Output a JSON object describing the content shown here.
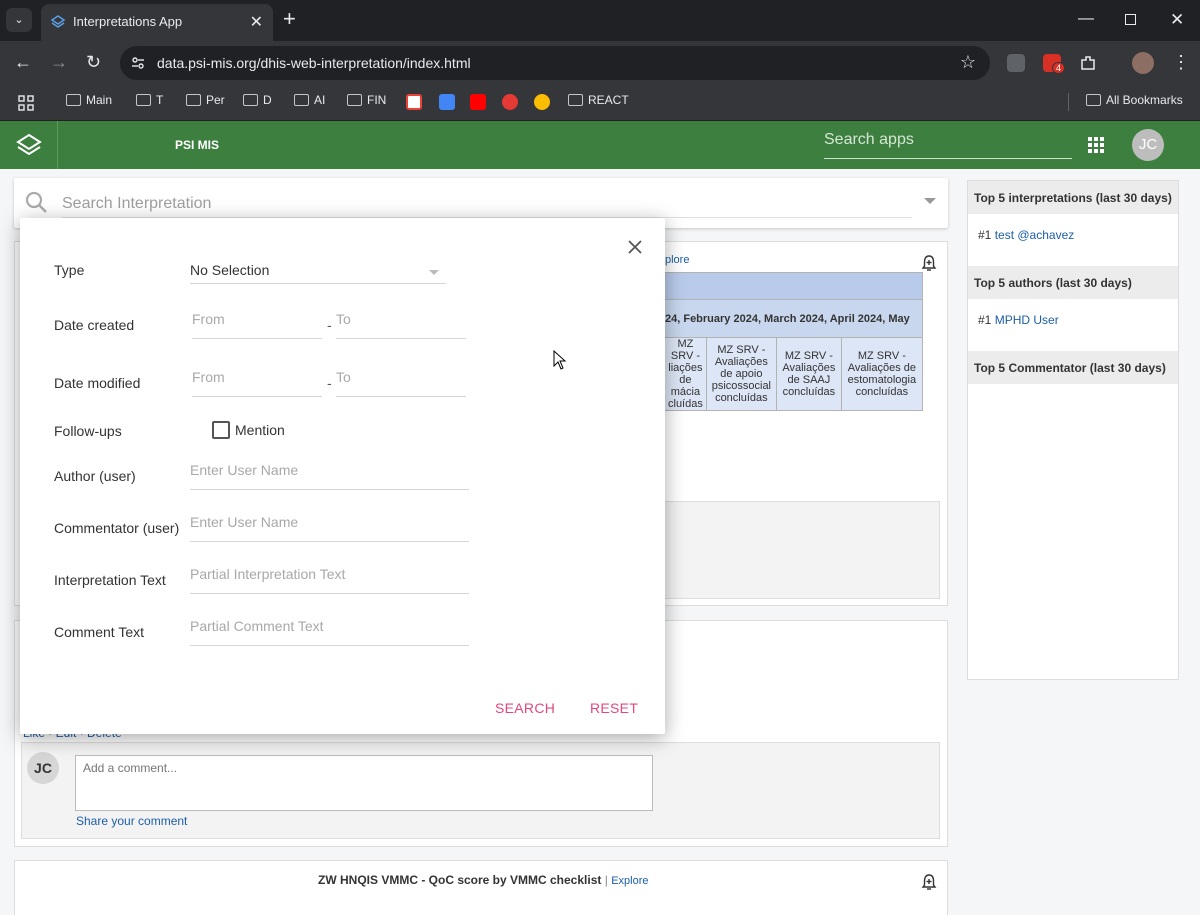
{
  "browser": {
    "tab_title": "Interpretations App",
    "url": "data.psi-mis.org/dhis-web-interpretation/index.html",
    "extension_badge": "4",
    "bookmarks": [
      "Main",
      "T",
      "Per",
      "D",
      "AI",
      "FIN",
      "REACT"
    ],
    "all_bookmarks": "All Bookmarks"
  },
  "app": {
    "name": "PSI MIS",
    "search_placeholder": "Search apps",
    "user_initials": "JC"
  },
  "search": {
    "placeholder": "Search Interpretation"
  },
  "card1": {
    "explore_label": "plore",
    "pivot_header": "24, February 2024, March 2024, April 2024, May",
    "pivot_columns": [
      "MZ SRV -\nliações\nde\nmácia\ncluídas",
      "MZ SRV -\nAvaliações\nde apoio\npsicossocial\nconcluídas",
      "MZ SRV -\nAvaliações\nde SAAJ\nconcluídas",
      "MZ SRV -\nAvaliações de\nestomatologia\nconcluídas"
    ]
  },
  "card2": {
    "actions": "Like · Edit · Delete",
    "comment_initials": "JC",
    "comment_placeholder": "Add a comment...",
    "share_label": "Share your comment"
  },
  "card3": {
    "title": "ZW HNQIS VMMC - QoC score by VMMC checklist",
    "separator": "|",
    "explore_label": "Explore"
  },
  "sidebar": {
    "top_interpretations": {
      "title": "Top 5 interpretations (last 30 days)",
      "rank": "#1",
      "item": "test @achavez"
    },
    "top_authors": {
      "title": "Top 5 authors (last 30 days)",
      "rank": "#1",
      "item": "MPHD User"
    },
    "top_commentators": {
      "title": "Top 5 Commentator (last 30 days)"
    }
  },
  "dialog": {
    "type_label": "Type",
    "type_value": "No Selection",
    "date_created_label": "Date created",
    "date_modified_label": "Date modified",
    "from_placeholder": "From",
    "to_placeholder": "To",
    "range_separator": "-",
    "followups_label": "Follow-ups",
    "mention_label": "Mention",
    "author_label": "Author (user)",
    "author_placeholder": "Enter User Name",
    "commentator_label": "Commentator (user)",
    "commentator_placeholder": "Enter User Name",
    "interp_text_label": "Interpretation Text",
    "interp_text_placeholder": "Partial Interpretation Text",
    "comment_text_label": "Comment Text",
    "comment_text_placeholder": "Partial Comment Text",
    "search_button": "SEARCH",
    "reset_button": "RESET"
  },
  "colors": {
    "header_green": "#3d7f3e",
    "accent_pink": "#e04880",
    "link_blue": "#1c5ea8"
  }
}
